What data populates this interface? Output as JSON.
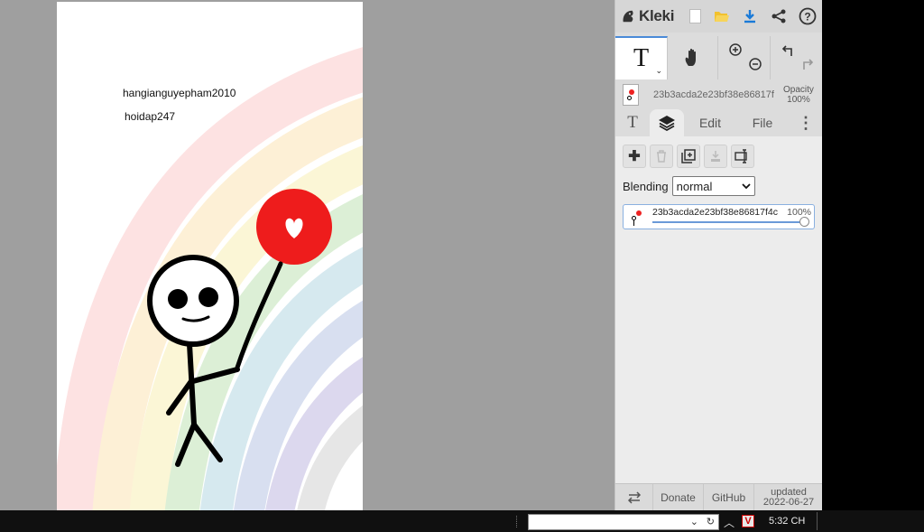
{
  "canvas": {
    "text_lines": [
      "hangianguyepham2010",
      "hoidap247"
    ]
  },
  "app": {
    "logo_text": "Kleki",
    "header_icons": [
      "new-image-icon",
      "open-folder-icon",
      "download-icon",
      "share-icon",
      "help-icon"
    ]
  },
  "tools": {
    "active_tool_glyph": "T",
    "zoom_in_glyph": "+",
    "zoom_out_glyph": "−"
  },
  "layer_info": {
    "name": "23b3acda2e23bf38e86817f",
    "opacity_label": "Opacity",
    "opacity_value": "100%"
  },
  "tabs": {
    "text_glyph": "T",
    "edit": "Edit",
    "file": "File"
  },
  "layers_panel": {
    "blending_label": "Blending",
    "blending_value": "normal",
    "layer_name": "23b3acda2e23bf38e86817f4c",
    "layer_opacity": "100%",
    "layer_opacity_fraction": 1.0
  },
  "footer": {
    "donate": "Donate",
    "github": "GitHub",
    "updated_label": "updated",
    "updated_date": "2022-06-27"
  },
  "taskbar": {
    "clock": "5:32 CH",
    "app_badge": "V"
  },
  "colors": {
    "accent_blue": "#1a7ad8",
    "balloon_red": "#ee1c1c",
    "panel_bg": "#dcdcdc",
    "workspace_bg": "#9f9f9f"
  }
}
